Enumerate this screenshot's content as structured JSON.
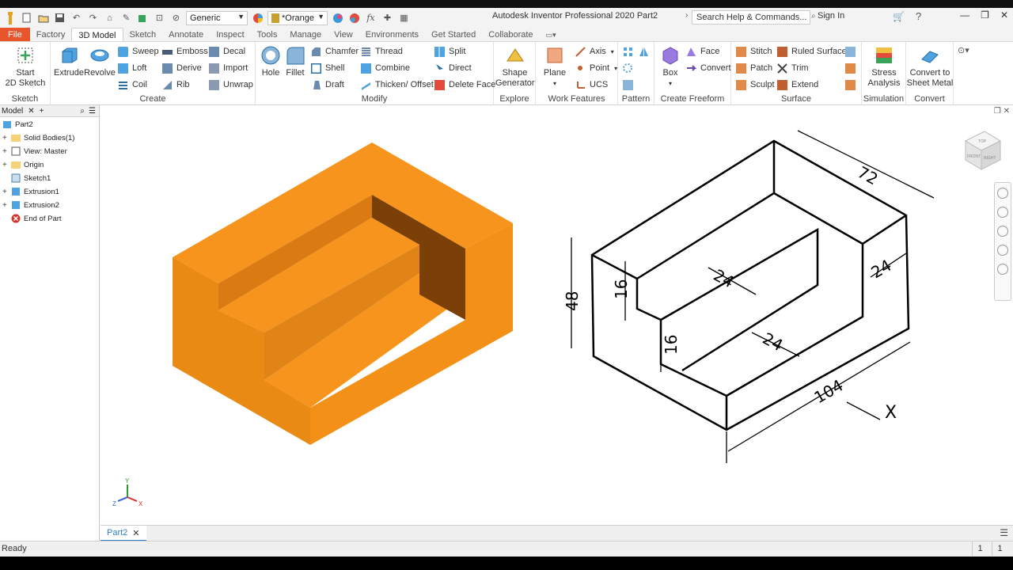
{
  "titlebar": {
    "app_title": "Autodesk Inventor Professional 2020   Part2",
    "search_placeholder": "Search Help & Commands...",
    "sign_in": "Sign In",
    "appearance_dropdown": "Generic",
    "material_dropdown": "*Orange",
    "fx_label": "fx"
  },
  "tabs": [
    {
      "label": "File"
    },
    {
      "label": "Factory"
    },
    {
      "label": "3D Model"
    },
    {
      "label": "Sketch"
    },
    {
      "label": "Annotate"
    },
    {
      "label": "Inspect"
    },
    {
      "label": "Tools"
    },
    {
      "label": "Manage"
    },
    {
      "label": "View"
    },
    {
      "label": "Environments"
    },
    {
      "label": "Get Started"
    },
    {
      "label": "Collaborate"
    }
  ],
  "ribbon": {
    "sketch": {
      "label": "Sketch",
      "start_sketch_1": "Start",
      "start_sketch_2": "2D Sketch"
    },
    "create": {
      "label": "Create",
      "extrude": "Extrude",
      "revolve": "Revolve",
      "sweep": "Sweep",
      "loft": "Loft",
      "coil": "Coil",
      "emboss": "Emboss",
      "derive": "Derive",
      "rib": "Rib",
      "decal": "Decal",
      "import": "Import",
      "unwrap": "Unwrap"
    },
    "modify": {
      "label": "Modify",
      "hole": "Hole",
      "fillet": "Fillet",
      "chamfer": "Chamfer",
      "shell": "Shell",
      "draft": "Draft",
      "thread": "Thread",
      "combine": "Combine",
      "thicken": "Thicken/ Offset",
      "split": "Split",
      "direct": "Direct",
      "delete_face": "Delete Face"
    },
    "explore": {
      "label": "Explore",
      "shape_gen_1": "Shape",
      "shape_gen_2": "Generator"
    },
    "work_features": {
      "label": "Work Features",
      "plane": "Plane",
      "axis": "Axis",
      "point": "Point",
      "ucs": "UCS"
    },
    "pattern": {
      "label": "Pattern"
    },
    "create_freeform": {
      "label": "Create Freeform",
      "box": "Box",
      "face": "Face",
      "convert": "Convert"
    },
    "surface": {
      "label": "Surface",
      "stitch": "Stitch",
      "patch": "Patch",
      "sculpt": "Sculpt",
      "ruled_surface": "Ruled Surface",
      "trim": "Trim",
      "extend": "Extend"
    },
    "simulation": {
      "label": "Simulation",
      "stress_1": "Stress",
      "stress_2": "Analysis"
    },
    "convert": {
      "label": "Convert",
      "sheet_metal_1": "Convert to",
      "sheet_metal_2": "Sheet Metal"
    }
  },
  "browser": {
    "header_label": "Model",
    "items": [
      {
        "label": "Part2"
      },
      {
        "label": "Solid Bodies(1)"
      },
      {
        "label": "View: Master"
      },
      {
        "label": "Origin"
      },
      {
        "label": "Sketch1"
      },
      {
        "label": "Extrusion1"
      },
      {
        "label": "Extrusion2"
      },
      {
        "label": "End of Part"
      }
    ]
  },
  "drawing": {
    "dim_72": "72",
    "dim_48": "48",
    "dim_16a": "16",
    "dim_16b": "16",
    "dim_24a": "24",
    "dim_24b": "24",
    "dim_24c": "24",
    "dim_104": "104",
    "view_label": "X"
  },
  "triad": {
    "x": "X",
    "y": "Y",
    "z": "Z"
  },
  "viewcube": {
    "front": "FRONT",
    "right": "RIGHT",
    "top": "TOP"
  },
  "doc_tab": {
    "label": "Part2"
  },
  "status": {
    "text": "Ready",
    "num1": "1",
    "num2": "1"
  },
  "colors": {
    "accent": "#2f80c7",
    "file_tab": "#e8542c",
    "part_orange": "#f7941d"
  }
}
